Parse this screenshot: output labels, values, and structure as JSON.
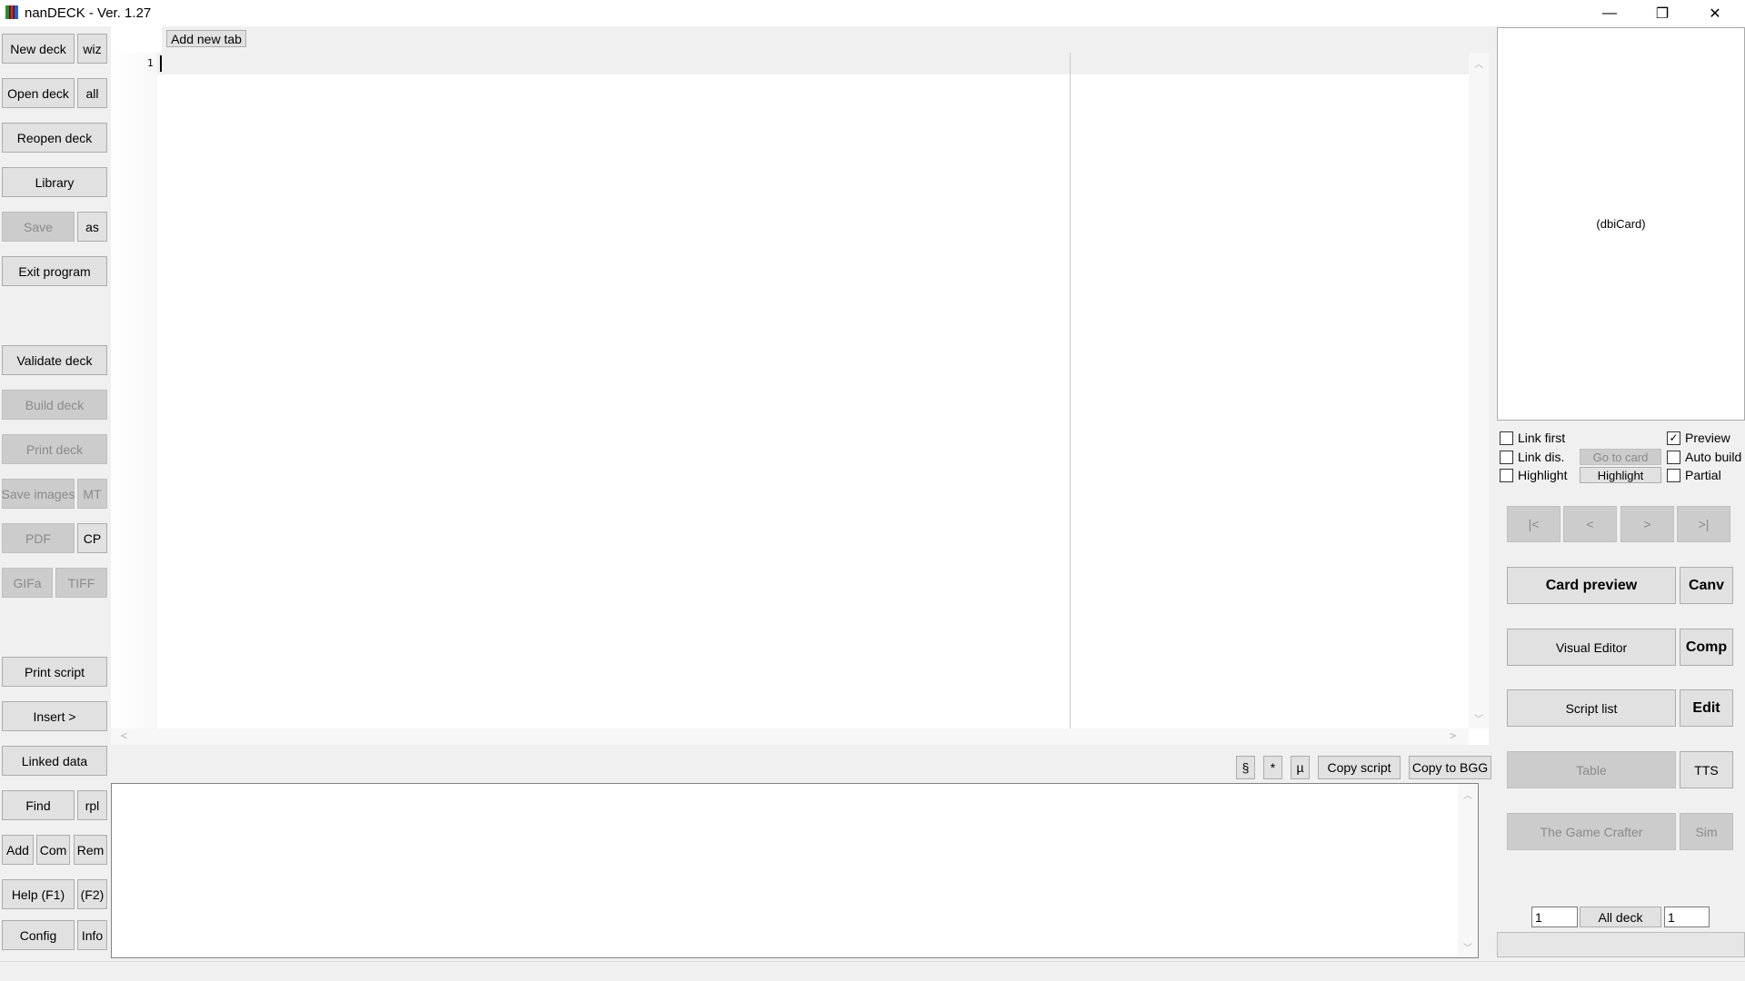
{
  "window": {
    "title": "nanDECK - Ver. 1.27",
    "minimize": "—",
    "maximize": "❐",
    "close": "✕"
  },
  "sidebar": {
    "new_deck": "New deck",
    "wiz": "wiz",
    "open_deck": "Open deck",
    "all": "all",
    "reopen_deck": "Reopen deck",
    "library": "Library",
    "save": "Save",
    "as": "as",
    "exit_program": "Exit program",
    "validate_deck": "Validate deck",
    "build_deck": "Build deck",
    "print_deck": "Print deck",
    "save_images": "Save images",
    "mt": "MT",
    "pdf": "PDF",
    "cp": "CP",
    "gifa": "GIFa",
    "tiff": "TIFF",
    "print_script": "Print script",
    "insert": "Insert >",
    "linked_data": "Linked data",
    "find": "Find",
    "rpl": "rpl",
    "add": "Add",
    "com": "Com",
    "rem": "Rem",
    "help": "Help (F1)",
    "f2": "(F2)",
    "config": "Config",
    "info": "Info"
  },
  "editor": {
    "add_new_tab": "Add new tab",
    "line_numbers": [
      "1"
    ],
    "content": ""
  },
  "toolbar": {
    "section": "§",
    "asterisk": "*",
    "mu": "µ",
    "copy_script": "Copy script",
    "copy_to_bgg": "Copy to BGG"
  },
  "log": {
    "content": ""
  },
  "right": {
    "preview_label": "(dbiCard)",
    "link_first": {
      "label": "Link first",
      "checked": false
    },
    "link_dis": {
      "label": "Link dis.",
      "checked": false
    },
    "highlight_cb": {
      "label": "Highlight",
      "checked": false
    },
    "preview_cb": {
      "label": "Preview",
      "checked": true
    },
    "auto_build": {
      "label": "Auto build",
      "checked": false
    },
    "partial": {
      "label": "Partial",
      "checked": false
    },
    "go_to_card": "Go to card",
    "highlight_btn": "Highlight",
    "nav": {
      "first": "|<",
      "prev": "<",
      "next": ">",
      "last": ">|"
    },
    "card_preview": "Card preview",
    "canv": "Canv",
    "visual_editor": "Visual Editor",
    "comp": "Comp",
    "script_list": "Script list",
    "edit": "Edit",
    "table": "Table",
    "tts": "TTS",
    "game_crafter": "The Game Crafter",
    "sim": "Sim",
    "from_card": "1",
    "all_deck": "All deck",
    "to_card": "1",
    "progress": 0
  }
}
